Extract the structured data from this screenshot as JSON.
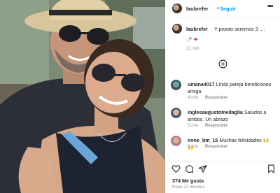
{
  "post": {
    "username": "laubrefer",
    "separator": "•",
    "follow_label": "Seguir",
    "more_icon": "more-options-icon"
  },
  "caption": {
    "username": "laubrefer",
    "text": "Y pronto seremos 3 ....",
    "emojis": [
      "🍼",
      "❤"
    ],
    "time": "21 min"
  },
  "load_more_icon": "plus-circle-icon",
  "comments": [
    {
      "username": "umana4017",
      "text": "Linda pareja bendiciones amiga",
      "time": "4 min",
      "reply_label": "Responder"
    },
    {
      "username": "inglesaugustomedaglia",
      "text": "Saludos a ambos. Un abrazo",
      "time": "5 min",
      "reply_label": "Responder"
    },
    {
      "username": "irene_bm_15",
      "text": "Muchas felicidades 🙌 🙌",
      "time": "5 min",
      "reply_label": "Responder"
    }
  ],
  "actions": {
    "icons": [
      "heart-icon",
      "comment-icon",
      "share-icon",
      "save-icon"
    ]
  },
  "likes": "374 Me gusta",
  "posted": "Hace 21 minutos",
  "colors": {
    "link": "#0095f6",
    "muted": "#8e8e8e",
    "text": "#262626"
  }
}
